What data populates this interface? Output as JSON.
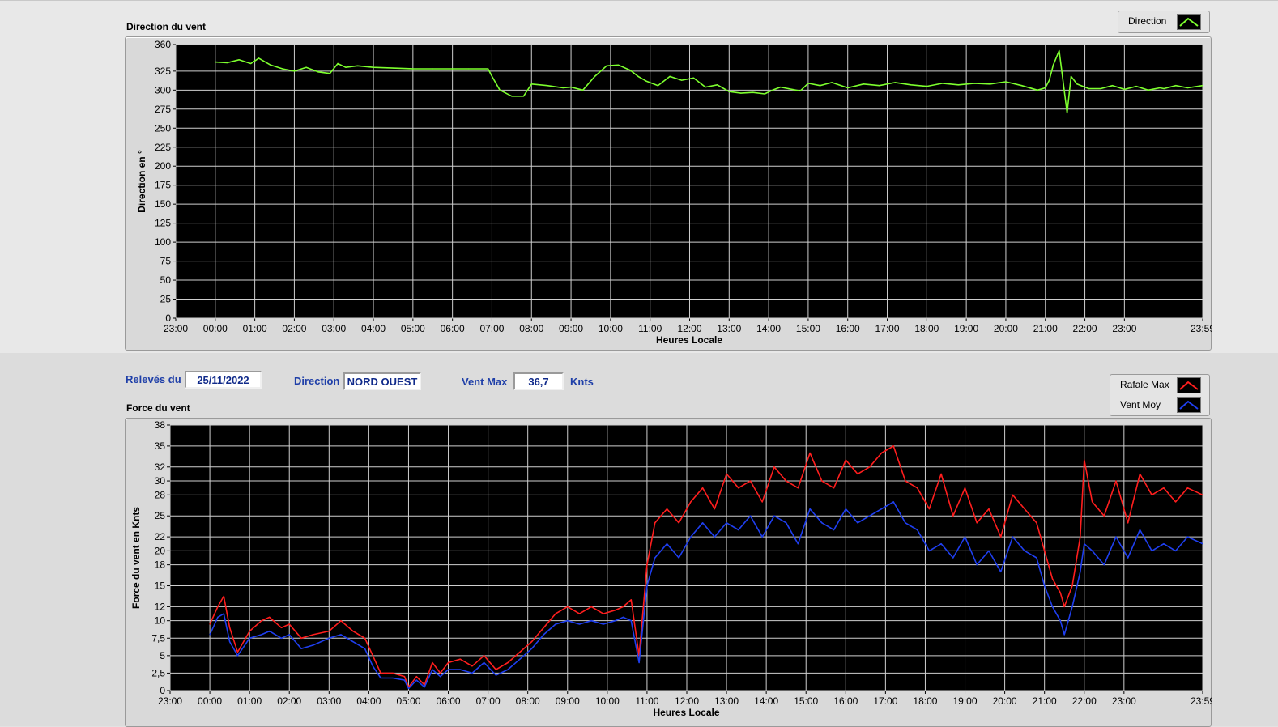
{
  "direction_panel": {
    "title": "Direction du vent",
    "legend_label": "Direction"
  },
  "controls": {
    "date_label": "Relevés du",
    "date_value": "25/11/2022",
    "direction_label": "Direction",
    "direction_value": "NORD OUEST",
    "ventmax_label": "Vent Max",
    "ventmax_value": "36,7",
    "ventmax_unit": "Knts"
  },
  "force_panel": {
    "title": "Force du vent",
    "legend_rafale": "Rafale Max",
    "legend_moy": "Vent Moy"
  },
  "colors": {
    "plot_bg": "#000000",
    "grid": "#cfcfcf",
    "direction": "#7dff2e",
    "rafale": "#ff1e1e",
    "moyen": "#1f3ff0"
  },
  "chart_data": [
    {
      "type": "line",
      "title": "Direction du vent",
      "xlabel": "Heures Locale",
      "ylabel": "Direction en °",
      "x_ticks": [
        "23:00",
        "00:00",
        "01:00",
        "02:00",
        "03:00",
        "04:00",
        "05:00",
        "06:00",
        "07:00",
        "08:00",
        "09:00",
        "10:00",
        "11:00",
        "12:00",
        "13:00",
        "14:00",
        "15:00",
        "16:00",
        "17:00",
        "18:00",
        "19:00",
        "20:00",
        "21:00",
        "22:00",
        "23:00",
        "23:59"
      ],
      "y_ticks": [
        "0",
        "25",
        "50",
        "75",
        "100",
        "125",
        "150",
        "175",
        "200",
        "225",
        "250",
        "275",
        "300",
        "325",
        "360"
      ],
      "ylim": [
        0,
        360
      ],
      "xlim_hours": [
        -1,
        24.98
      ],
      "legend": "top-right",
      "grid": true,
      "series": [
        {
          "name": "Direction",
          "x": [
            0.0,
            0.3,
            0.6,
            0.9,
            1.1,
            1.4,
            1.7,
            2.0,
            2.3,
            2.6,
            2.9,
            3.1,
            3.3,
            3.6,
            4.0,
            4.5,
            5.0,
            5.5,
            6.0,
            6.4,
            6.9,
            7.0,
            7.2,
            7.5,
            7.8,
            8.0,
            8.4,
            8.8,
            9.0,
            9.3,
            9.6,
            9.9,
            10.2,
            10.5,
            10.7,
            10.9,
            11.2,
            11.5,
            11.8,
            12.1,
            12.4,
            12.7,
            13.0,
            13.3,
            13.6,
            13.9,
            14.1,
            14.3,
            14.5,
            14.8,
            15.0,
            15.3,
            15.6,
            16.0,
            16.4,
            16.8,
            17.2,
            17.6,
            18.0,
            18.4,
            18.8,
            19.2,
            19.6,
            20.0,
            20.4,
            20.8,
            21.0,
            21.1,
            21.2,
            21.35,
            21.55,
            21.65,
            21.8,
            22.1,
            22.4,
            22.7,
            23.0,
            23.3,
            23.6,
            23.9,
            24.0,
            24.3,
            24.6,
            24.98
          ],
          "y": [
            337,
            336,
            340,
            335,
            342,
            333,
            328,
            325,
            330,
            324,
            322,
            335,
            330,
            332,
            330,
            329,
            328,
            328,
            328,
            328,
            328,
            318,
            300,
            292,
            292,
            308,
            306,
            303,
            304,
            300,
            318,
            332,
            333,
            326,
            318,
            312,
            306,
            318,
            313,
            316,
            304,
            307,
            298,
            296,
            297,
            295,
            300,
            304,
            302,
            299,
            309,
            306,
            310,
            303,
            308,
            306,
            310,
            307,
            305,
            309,
            307,
            309,
            308,
            311,
            306,
            300,
            303,
            313,
            333,
            352,
            270,
            318,
            308,
            302,
            302,
            306,
            301,
            305,
            300,
            303,
            302,
            306,
            303,
            306
          ]
        }
      ]
    },
    {
      "type": "line",
      "title": "Force du vent",
      "xlabel": "Heures Locale",
      "ylabel": "Force du vent en Knts",
      "x_ticks": [
        "23:00",
        "00:00",
        "01:00",
        "02:00",
        "03:00",
        "04:00",
        "05:00",
        "06:00",
        "07:00",
        "08:00",
        "09:00",
        "10:00",
        "11:00",
        "12:00",
        "13:00",
        "14:00",
        "15:00",
        "16:00",
        "17:00",
        "18:00",
        "19:00",
        "20:00",
        "21:00",
        "22:00",
        "23:00",
        "23:59"
      ],
      "y_ticks": [
        "0",
        "2,5",
        "5",
        "7,5",
        "10",
        "12",
        "15",
        "18",
        "20",
        "22",
        "25",
        "28",
        "30",
        "32",
        "35",
        "38"
      ],
      "ylim": [
        0,
        38
      ],
      "xlim_hours": [
        -1,
        24.98
      ],
      "legend": "top-right",
      "grid": true,
      "series": [
        {
          "name": "Rafale Max",
          "x": [
            0.0,
            0.2,
            0.35,
            0.5,
            0.7,
            1.0,
            1.3,
            1.5,
            1.8,
            2.0,
            2.3,
            2.6,
            3.0,
            3.3,
            3.6,
            3.9,
            4.1,
            4.3,
            4.6,
            4.9,
            5.0,
            5.2,
            5.4,
            5.6,
            5.8,
            6.0,
            6.3,
            6.6,
            6.9,
            7.2,
            7.5,
            7.8,
            8.1,
            8.4,
            8.7,
            9.0,
            9.3,
            9.6,
            9.9,
            10.2,
            10.4,
            10.6,
            10.8,
            11.0,
            11.2,
            11.5,
            11.8,
            12.1,
            12.4,
            12.7,
            13.0,
            13.3,
            13.6,
            13.9,
            14.2,
            14.5,
            14.8,
            15.1,
            15.4,
            15.7,
            16.0,
            16.3,
            16.6,
            16.9,
            17.2,
            17.5,
            17.8,
            18.1,
            18.4,
            18.7,
            19.0,
            19.3,
            19.6,
            19.9,
            20.2,
            20.5,
            20.8,
            21.0,
            21.2,
            21.4,
            21.5,
            21.7,
            21.9,
            22.0,
            22.2,
            22.5,
            22.8,
            23.1,
            23.4,
            23.7,
            24.0,
            24.3,
            24.6,
            24.98
          ],
          "y": [
            9.5,
            12,
            13.5,
            9,
            5.5,
            8.5,
            10,
            10.5,
            9,
            9.5,
            7.5,
            8,
            8.5,
            10,
            8.5,
            7.5,
            5,
            2.5,
            2.5,
            2,
            0.5,
            2,
            0.8,
            4,
            2.5,
            4,
            4.5,
            3.5,
            5,
            3,
            4,
            5.5,
            7,
            9,
            11,
            12,
            11,
            12,
            11,
            11.5,
            12,
            13,
            5,
            18,
            24,
            26,
            24,
            27,
            29,
            26,
            31,
            29,
            30,
            27,
            32,
            30,
            29,
            34,
            30,
            29,
            33,
            31,
            32,
            34,
            35,
            30,
            29,
            26,
            31,
            25,
            29,
            24,
            26,
            22,
            28,
            26,
            24,
            20,
            16,
            14,
            12,
            15,
            22,
            33,
            27,
            25,
            30,
            24,
            31,
            28,
            29,
            27,
            29,
            28
          ]
        },
        {
          "name": "Vent Moy",
          "x": [
            0.0,
            0.2,
            0.35,
            0.5,
            0.7,
            1.0,
            1.3,
            1.5,
            1.8,
            2.0,
            2.3,
            2.6,
            3.0,
            3.3,
            3.6,
            3.9,
            4.1,
            4.3,
            4.6,
            4.9,
            5.0,
            5.2,
            5.4,
            5.6,
            5.8,
            6.0,
            6.3,
            6.6,
            6.9,
            7.2,
            7.5,
            7.8,
            8.1,
            8.4,
            8.7,
            9.0,
            9.3,
            9.6,
            9.9,
            10.2,
            10.4,
            10.6,
            10.8,
            11.0,
            11.2,
            11.5,
            11.8,
            12.1,
            12.4,
            12.7,
            13.0,
            13.3,
            13.6,
            13.9,
            14.2,
            14.5,
            14.8,
            15.1,
            15.4,
            15.7,
            16.0,
            16.3,
            16.6,
            16.9,
            17.2,
            17.5,
            17.8,
            18.1,
            18.4,
            18.7,
            19.0,
            19.3,
            19.6,
            19.9,
            20.2,
            20.5,
            20.8,
            21.0,
            21.2,
            21.4,
            21.5,
            21.7,
            21.9,
            22.0,
            22.2,
            22.5,
            22.8,
            23.1,
            23.4,
            23.7,
            24.0,
            24.3,
            24.6,
            24.98
          ],
          "y": [
            8,
            10.5,
            11,
            7,
            5,
            7.5,
            8,
            8.5,
            7.5,
            8,
            6,
            6.5,
            7.5,
            8,
            7,
            6,
            3.5,
            1.8,
            1.8,
            1.5,
            0.3,
            1.5,
            0.5,
            3,
            2,
            3,
            3,
            2.5,
            4,
            2.2,
            3,
            4.5,
            6,
            8,
            9.5,
            10,
            9.5,
            10,
            9.5,
            10,
            10.5,
            10,
            4,
            15,
            19,
            21,
            19,
            22,
            24,
            22,
            24,
            23,
            25,
            22,
            25,
            24,
            21,
            26,
            24,
            23,
            26,
            24,
            25,
            26,
            27,
            24,
            23,
            20,
            21,
            19,
            22,
            18,
            20,
            17,
            22,
            20,
            19,
            15,
            12,
            10,
            8,
            12,
            17,
            21,
            20,
            18,
            22,
            19,
            23,
            20,
            21,
            20,
            22,
            21
          ]
        }
      ]
    }
  ]
}
